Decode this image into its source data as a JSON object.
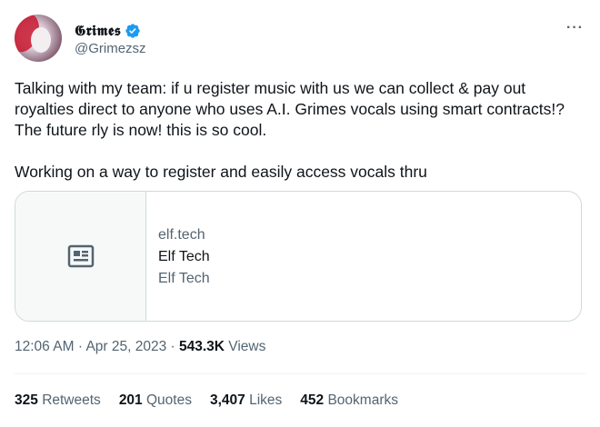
{
  "author": {
    "display_name": "𝕲𝖗𝖎𝖒𝖊𝖘",
    "handle": "@Grimezsz"
  },
  "icons": {
    "avatar": "profile-avatar",
    "verified": "verified-badge-icon",
    "more": "more-icon",
    "card_media": "article-icon"
  },
  "colors": {
    "verified": "#1d9bf0",
    "secondary_text": "#536471",
    "border": "#cfd9de"
  },
  "tweet": {
    "paragraph_1": "Talking with my team:  if u register music with us we can collect & pay out royalties direct to anyone who uses A.I. Grimes vocals using smart contracts!?  The future rly is now!  this is so cool.",
    "paragraph_2": "Working on a way to register and easily access vocals thru"
  },
  "card": {
    "domain": "elf.tech",
    "title": "Elf Tech",
    "description": "Elf Tech"
  },
  "meta": {
    "time": "12:06 AM",
    "separator_1": "·",
    "date": "Apr 25, 2023",
    "separator_2": "·",
    "views_count": "543.3K",
    "views_label": "Views"
  },
  "stats": [
    {
      "count": "325",
      "label": "Retweets"
    },
    {
      "count": "201",
      "label": "Quotes"
    },
    {
      "count": "3,407",
      "label": "Likes"
    },
    {
      "count": "452",
      "label": "Bookmarks"
    }
  ]
}
